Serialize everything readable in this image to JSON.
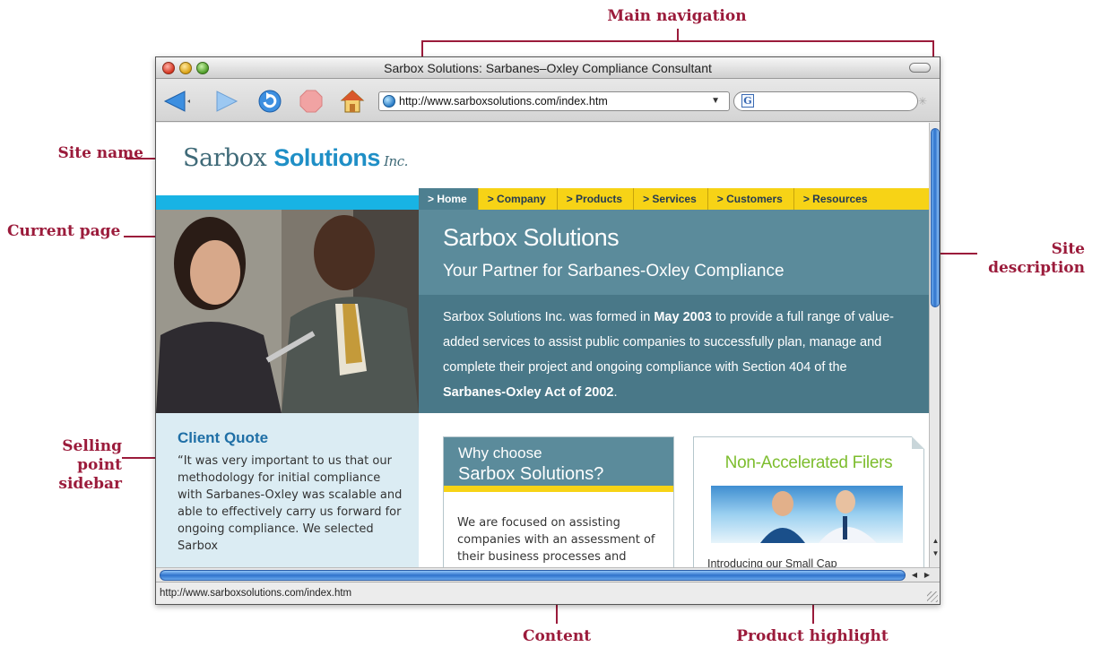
{
  "annotations": {
    "main_navigation": "Main navigation",
    "site_name": "Site name",
    "current_page": "Current page",
    "site_description_1": "Site",
    "site_description_2": "description",
    "selling_point_1": "Selling",
    "selling_point_2": "point",
    "selling_point_3": "sidebar",
    "content": "Content",
    "product_highlight": "Product highlight"
  },
  "browser": {
    "title": "Sarbox Solutions: Sarbanes–Oxley Compliance Consultant",
    "url": "http://www.sarboxsolutions.com/index.htm",
    "status": "http://www.sarboxsolutions.com/index.htm"
  },
  "site": {
    "logo": {
      "part1": "Sarbox ",
      "part2": "Solutions",
      "part3": " Inc."
    },
    "nav": [
      "> Home",
      "> Company",
      "> Products",
      "> Services",
      "> Customers",
      "> Resources"
    ],
    "hero": {
      "title": "Sarbox Solutions",
      "subtitle": "Your Partner for Sarbanes-Oxley Compliance",
      "body_1": "Sarbox Solutions Inc. was formed in ",
      "body_bold_1": "May 2003",
      "body_2": " to provide a full range of value-added services to assist public companies to successfully plan, manage and complete their project and ongoing compliance with Section 404 of the ",
      "body_bold_2": "Sarbanes-Oxley Act of 2002",
      "body_3": "."
    },
    "quote": {
      "title": "Client Quote",
      "text": "“It was very important to us that our methodology for initial compliance with Sarbanes-Oxley was scalable and able to effectively carry us forward for ongoing compliance. We selected Sarbox"
    },
    "why": {
      "line1": "Why choose",
      "line2": "Sarbox Solutions?",
      "body": "We are focused on assisting companies with an assessment of their business processes and"
    },
    "product": {
      "title": "Non-Accelerated Filers",
      "body": "Introducing our Small Cap"
    }
  },
  "colors": {
    "annotation": "#9b1b3b",
    "nav_tab": "#f7d316",
    "nav_active": "#4d7f90",
    "hero": "#497888",
    "cyan_strip": "#18b3e4",
    "product_title": "#7dbd2e"
  }
}
